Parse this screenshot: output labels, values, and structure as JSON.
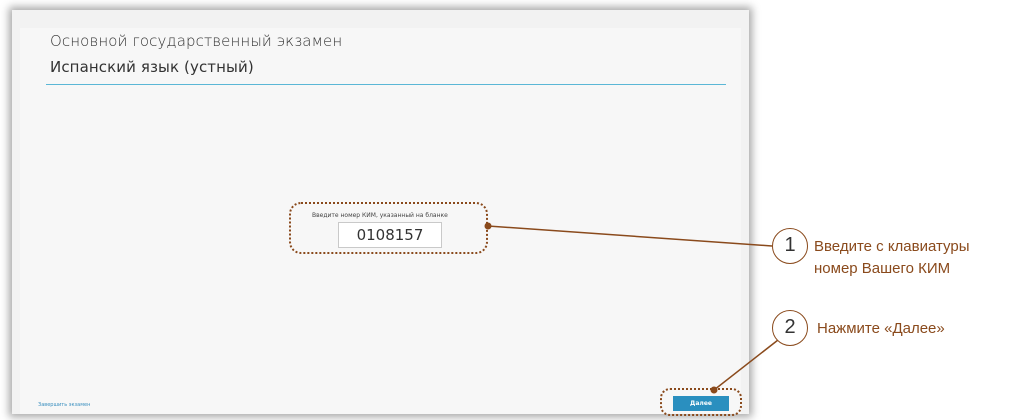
{
  "exam": {
    "title_line1": "Основной государственный экзамен",
    "title_line2": "Испанский язык (устный)"
  },
  "kim_form": {
    "label": "Введите номер КИМ, указанный на бланке",
    "value": "0108157"
  },
  "footer": {
    "finish_link": "Завершить экзамен",
    "next_button": "Далее"
  },
  "annotations": {
    "step1_number": "1",
    "step1_line1": "Введите с клавиатуры",
    "step1_line2": "номер Вашего КИМ",
    "step2_number": "2",
    "step2_text": "Нажмите «Далее»"
  },
  "colors": {
    "accent_line": "#5bb7d6",
    "button": "#2a8fbf",
    "callout": "#8a4a1c"
  }
}
